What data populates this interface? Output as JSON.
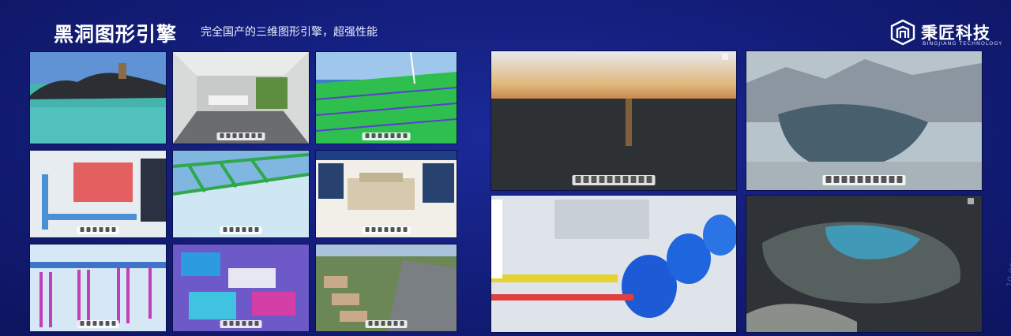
{
  "header": {
    "title": "黑洞图形引擎",
    "subtitle": "完全国产的三维图形引擎，超强性能"
  },
  "logo": {
    "name": "秉匠科技",
    "english": "BINGJIANG TECHNOLOGY"
  },
  "watermark": "10,000",
  "colors": {
    "background": "#141f7e",
    "accent": "#2ec8ff"
  },
  "thumbnails": [
    {
      "id": "island"
    },
    {
      "id": "office-interior"
    },
    {
      "id": "bridge-rebar"
    },
    {
      "id": "mep-pipes"
    },
    {
      "id": "steel-truss"
    },
    {
      "id": "building-dashboard"
    },
    {
      "id": "bridge-piers"
    },
    {
      "id": "bim-model"
    },
    {
      "id": "city-aerial"
    },
    {
      "id": "ocean-sunset"
    },
    {
      "id": "mountain-lake"
    },
    {
      "id": "industrial-tanks"
    },
    {
      "id": "terrain-map"
    }
  ]
}
